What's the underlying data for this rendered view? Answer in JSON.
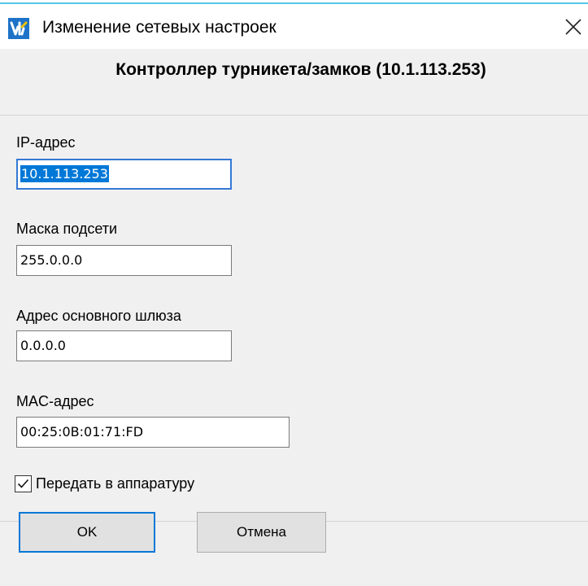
{
  "window": {
    "title": "Изменение сетевых настроек",
    "icon": "parsec-logo-icon",
    "close_icon": "close-icon"
  },
  "header": {
    "title": "Контроллер турникета/замков (10.1.113.253)"
  },
  "form": {
    "ip": {
      "label": "IP-адрес",
      "value": "10.1.113.253"
    },
    "mask": {
      "label": "Маска подсети",
      "value": "255.0.0.0"
    },
    "gateway": {
      "label": "Адрес основного шлюза",
      "value": "0.0.0.0"
    },
    "mac": {
      "label": "MAC-адрес",
      "value": "00:25:0B:01:71:FD"
    }
  },
  "checkbox": {
    "label": "Передать в аппаратуру",
    "checked": true
  },
  "buttons": {
    "ok": "OK",
    "cancel": "Отмена"
  },
  "colors": {
    "accent": "#0078d7",
    "icon_blue": "#1e73c8",
    "background": "#f0f0f0"
  }
}
